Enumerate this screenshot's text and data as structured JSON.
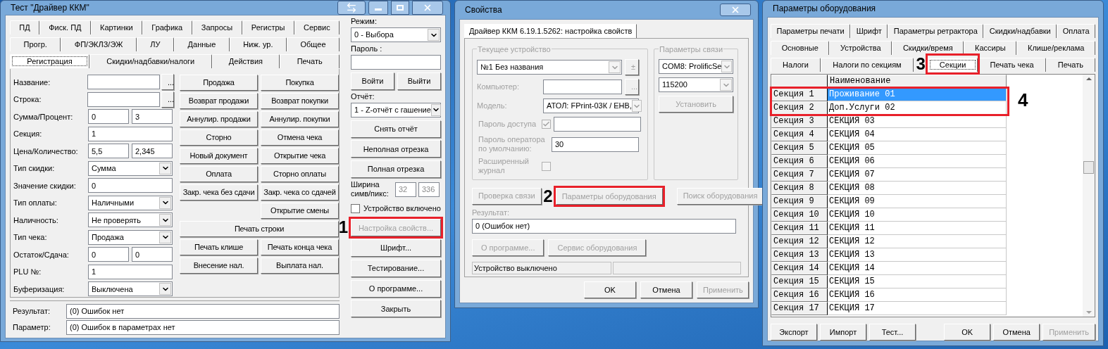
{
  "driver_test_window": {
    "title": "Тест \"Драйвер ККМ\"",
    "tab_rows": [
      [
        {
          "label": "ПД",
          "selected": false
        },
        {
          "label": "Фиск. ПД",
          "selected": false
        },
        {
          "label": "Картинки",
          "selected": false
        },
        {
          "label": "Графика",
          "selected": false
        },
        {
          "label": "Запросы",
          "selected": false
        },
        {
          "label": "Регистры",
          "selected": false
        },
        {
          "label": "Сервис",
          "selected": false
        }
      ],
      [
        {
          "label": "Прогр.",
          "selected": false
        },
        {
          "label": "ФП/ЭКЛЗ/ЭЖ",
          "selected": false
        },
        {
          "label": "ЛУ",
          "selected": false
        },
        {
          "label": "Данные",
          "selected": false
        },
        {
          "label": "Ниж. ур.",
          "selected": false
        },
        {
          "label": "Общее",
          "selected": false
        }
      ],
      [
        {
          "label": "Регистрация",
          "selected": true
        },
        {
          "label": "Скидки/надбавки/налоги",
          "selected": false
        },
        {
          "label": "Действия",
          "selected": false
        },
        {
          "label": "Печать",
          "selected": false
        }
      ]
    ],
    "fields": [
      {
        "label": "Название:",
        "kind": "browse",
        "button": "..."
      },
      {
        "label": "Строка:",
        "kind": "browse",
        "button": "..."
      },
      {
        "label": "Сумма/Процент:",
        "kind": "pair",
        "values": [
          "0",
          "3"
        ]
      },
      {
        "label": "Секция:",
        "kind": "text",
        "value": "1"
      },
      {
        "label": "Цена/Количество:",
        "kind": "pair",
        "values": [
          "5,5",
          "2,345"
        ]
      },
      {
        "label": "Тип скидки:",
        "kind": "combo",
        "value": "Сумма"
      },
      {
        "label": "Значение скидки:",
        "kind": "text",
        "value": "0"
      },
      {
        "label": "Тип оплаты:",
        "kind": "combo",
        "value": "Наличными"
      },
      {
        "label": "Наличность:",
        "kind": "combo",
        "value": "Не проверять"
      },
      {
        "label": "Тип чека:",
        "kind": "combo",
        "value": "Продажа"
      },
      {
        "label": "Остаток/Сдача:",
        "kind": "pair",
        "values": [
          "0",
          "0"
        ]
      },
      {
        "label": "PLU №:",
        "kind": "text",
        "value": "1"
      },
      {
        "label": "Буферизация:",
        "kind": "combo",
        "value": "Выключена"
      }
    ],
    "action_rows": [
      {
        "kind": "pair",
        "buttons": [
          "Продажа",
          "Покупка"
        ]
      },
      {
        "kind": "pair",
        "buttons": [
          "Возврат продажи",
          "Возврат покупки"
        ]
      },
      {
        "kind": "pair",
        "buttons": [
          "Аннулир. продажи",
          "Аннулир. покупки"
        ]
      },
      {
        "kind": "pair",
        "buttons": [
          "Сторно",
          "Отмена чека"
        ]
      },
      {
        "kind": "pair",
        "buttons": [
          "Новый документ",
          "Открытие чека"
        ]
      },
      {
        "kind": "pair",
        "buttons": [
          "Оплата",
          "Сторно оплаты"
        ]
      },
      {
        "kind": "pair",
        "buttons": [
          "Закр. чека без сдачи",
          "Закр. чека со сдачей"
        ]
      },
      {
        "kind": "right",
        "buttons": [
          "Открытие смены"
        ]
      },
      {
        "kind": "wide",
        "buttons": [
          "Печать строки"
        ]
      },
      {
        "kind": "pair",
        "buttons": [
          "Печать клише",
          "Печать конца чека"
        ]
      },
      {
        "kind": "pair",
        "buttons": [
          "Внесение нал.",
          "Выплата нал."
        ]
      }
    ],
    "side": [
      {
        "kind": "label",
        "text": "Режим:"
      },
      {
        "kind": "combo",
        "value": "0 - Выбора"
      },
      {
        "kind": "label",
        "text": "Пароль :"
      },
      {
        "kind": "field"
      },
      {
        "kind": "buttons",
        "buttons": [
          {
            "label": "Войти",
            "disabled": false
          },
          {
            "label": "Выйти",
            "disabled": false
          }
        ]
      },
      {
        "kind": "label",
        "text": "Отчёт:"
      },
      {
        "kind": "combo",
        "value": "1 - Z-отчёт с гашение"
      },
      {
        "kind": "buttons",
        "buttons": [
          {
            "label": "Снять отчёт",
            "disabled": false
          }
        ]
      },
      {
        "kind": "buttons",
        "buttons": [
          {
            "label": "Неполная отрезка",
            "disabled": false
          }
        ]
      },
      {
        "kind": "buttons",
        "buttons": [
          {
            "label": "Полная отрезка",
            "disabled": false
          }
        ]
      },
      {
        "kind": "width",
        "text": "Ширина симв/пикс:",
        "values": [
          "32",
          "336"
        ],
        "disabled": true
      },
      {
        "kind": "checkbox",
        "text": "Устройство включено",
        "checked": false
      },
      {
        "kind": "buttons",
        "buttons": [
          {
            "label": "Настройка свойств...",
            "disabled": true,
            "callout": "1"
          }
        ]
      },
      {
        "kind": "buttons",
        "buttons": [
          {
            "label": "Шрифт...",
            "disabled": false
          }
        ]
      },
      {
        "kind": "buttons",
        "buttons": [
          {
            "label": "Тестирование...",
            "disabled": false
          }
        ]
      },
      {
        "kind": "buttons",
        "buttons": [
          {
            "label": "О программе...",
            "disabled": false
          }
        ]
      },
      {
        "kind": "buttons",
        "buttons": [
          {
            "label": "Закрыть",
            "disabled": false
          }
        ]
      }
    ],
    "results": [
      {
        "label": "Результат:",
        "value": "(0) Ошибок нет"
      },
      {
        "label": "Параметр:",
        "value": "(0) Ошибок в параметрах нет"
      }
    ]
  },
  "properties_dialog": {
    "title": "Свойства",
    "tab": "Драйвер ККМ 6.19.1.5262: настройка свойств",
    "device_group": {
      "title": "Текущее устройство",
      "disabled": true,
      "device": "№1 Без названия",
      "device_button": "±",
      "computer_label": "Компьютер:",
      "computer_button": "...",
      "model_label": "Модель:",
      "model": "АТОЛ: FPrint-03К / ЕНВ,",
      "access_password_label": "Пароль доступа",
      "access_password_checked": true,
      "operator_password_label": "Пароль оператора по умолчанию:",
      "operator_password": "30",
      "extended_log_label": "Расширенный журнал",
      "extended_log_checked": false
    },
    "connection_group": {
      "title": "Параметры связи",
      "port": "COM8: ProlificSe",
      "baud": "115200",
      "apply_button": {
        "label": "Установить",
        "disabled": true
      }
    },
    "action_buttons": [
      {
        "label": "Проверка связи",
        "disabled": true
      },
      {
        "label": "Параметры оборудования",
        "disabled": true,
        "callout": "2"
      },
      {
        "label": "Поиск оборудования",
        "disabled": true
      }
    ],
    "result_label": "Результат:",
    "result": "0 (Ошибок нет)",
    "extra_buttons": [
      {
        "label": "О программе...",
        "disabled": true
      },
      {
        "label": "Сервис оборудования",
        "disabled": true
      }
    ],
    "status": "Устройство выключено",
    "buttons": [
      {
        "label": "OK",
        "disabled": false
      },
      {
        "label": "Отмена",
        "disabled": false
      },
      {
        "label": "Применить",
        "disabled": true
      }
    ]
  },
  "equipment_dialog": {
    "title": "Параметры оборудования",
    "tab_rows": [
      [
        {
          "label": "Параметры печати",
          "selected": false
        },
        {
          "label": "Шрифт",
          "selected": false
        },
        {
          "label": "Параметры ретрактора",
          "selected": false
        },
        {
          "label": "Скидки/надбавки",
          "selected": false
        },
        {
          "label": "Оплата",
          "selected": false
        }
      ],
      [
        {
          "label": "Основные",
          "selected": false
        },
        {
          "label": "Устройства",
          "selected": false
        },
        {
          "label": "Скидки/время",
          "selected": false
        },
        {
          "label": "Кассиры",
          "selected": false
        },
        {
          "label": "Клише/реклама",
          "selected": false
        }
      ],
      [
        {
          "label": "Налоги",
          "selected": false
        },
        {
          "label": "Налоги по секциям",
          "selected": false
        },
        {
          "label": "Секции",
          "selected": true,
          "callout": "3"
        },
        {
          "label": "Печать чека",
          "selected": false
        },
        {
          "label": "Печать",
          "selected": false
        }
      ]
    ],
    "grid": {
      "column": "Наименование",
      "callout": "4",
      "rows": [
        {
          "header": "Секция 1",
          "name": "Проживание 01",
          "selected": true,
          "highlighted": true
        },
        {
          "header": "Секция 2",
          "name": "Доп.Услуги 02",
          "selected": false,
          "highlighted": true
        },
        {
          "header": "Секция 3",
          "name": "СЕКЦИЯ 03",
          "selected": false,
          "highlighted": false
        },
        {
          "header": "Секция 4",
          "name": "СЕКЦИЯ 04",
          "selected": false,
          "highlighted": false
        },
        {
          "header": "Секция 5",
          "name": "СЕКЦИЯ 05",
          "selected": false,
          "highlighted": false
        },
        {
          "header": "Секция 6",
          "name": "СЕКЦИЯ 06",
          "selected": false,
          "highlighted": false
        },
        {
          "header": "Секция 7",
          "name": "СЕКЦИЯ 07",
          "selected": false,
          "highlighted": false
        },
        {
          "header": "Секция 8",
          "name": "СЕКЦИЯ 08",
          "selected": false,
          "highlighted": false
        },
        {
          "header": "Секция 9",
          "name": "СЕКЦИЯ 09",
          "selected": false,
          "highlighted": false
        },
        {
          "header": "Секция 10",
          "name": "СЕКЦИЯ 10",
          "selected": false,
          "highlighted": false
        },
        {
          "header": "Секция 11",
          "name": "СЕКЦИЯ 11",
          "selected": false,
          "highlighted": false
        },
        {
          "header": "Секция 12",
          "name": "СЕКЦИЯ 12",
          "selected": false,
          "highlighted": false
        },
        {
          "header": "Секция 13",
          "name": "СЕКЦИЯ 13",
          "selected": false,
          "highlighted": false
        },
        {
          "header": "Секция 14",
          "name": "СЕКЦИЯ 14",
          "selected": false,
          "highlighted": false
        },
        {
          "header": "Секция 15",
          "name": "СЕКЦИЯ 15",
          "selected": false,
          "highlighted": false
        },
        {
          "header": "Секция 16",
          "name": "СЕКЦИЯ 16",
          "selected": false,
          "highlighted": false
        },
        {
          "header": "Секция 17",
          "name": "СЕКЦИЯ 17",
          "selected": false,
          "highlighted": false
        }
      ]
    },
    "buttons": [
      {
        "label": "Экспорт",
        "disabled": false
      },
      {
        "label": "Импорт",
        "disabled": false
      },
      {
        "label": "Тест...",
        "disabled": false
      },
      {
        "label": "OK",
        "disabled": false
      },
      {
        "label": "Отмена",
        "disabled": false
      },
      {
        "label": "Применить",
        "disabled": true
      }
    ]
  }
}
